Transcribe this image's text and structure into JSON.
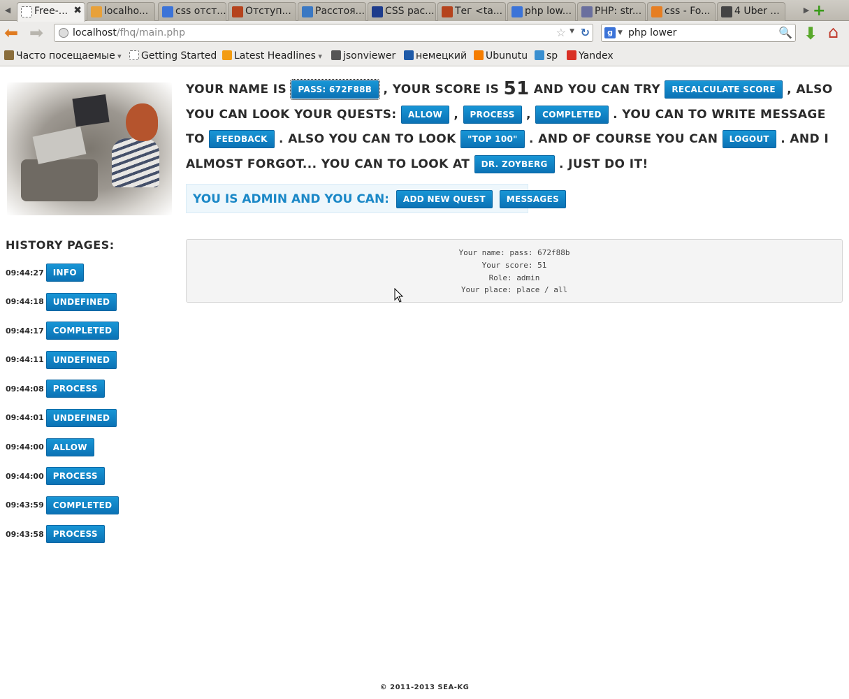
{
  "browser": {
    "tabs": [
      {
        "label": "Free-...",
        "icon": "page-icon",
        "color": "#ffffff",
        "active": true
      },
      {
        "label": "localho...",
        "icon": "pma-icon",
        "color": "#e8a13a"
      },
      {
        "label": "css отст...",
        "icon": "google-icon",
        "color": "#3b73d8"
      },
      {
        "label": "Отступ...",
        "icon": "htmlbook-icon",
        "color": "#b5431d"
      },
      {
        "label": "Расстоя...",
        "icon": "gear-icon",
        "color": "#3a78c3"
      },
      {
        "label": "CSS рас...",
        "icon": "a-icon",
        "color": "#1e3c8c"
      },
      {
        "label": "Тег <ta...",
        "icon": "htmlbook-icon",
        "color": "#b5431d"
      },
      {
        "label": "php low...",
        "icon": "google-icon",
        "color": "#3b73d8"
      },
      {
        "label": "PHP: str...",
        "icon": "php-icon",
        "color": "#6a6f9e"
      },
      {
        "label": "css - Fo...",
        "icon": "stackoverflow-icon",
        "color": "#e67e22"
      },
      {
        "label": "4 Uber ...",
        "icon": "page-icon",
        "color": "#444444"
      }
    ],
    "url_host": "localhost",
    "url_path": "/fhq/main.php",
    "search_value": "php lower",
    "bookmarks": [
      {
        "label": "Часто посещаемые",
        "icon": "most-visited-icon",
        "color": "#8a6d3b",
        "dropdown": true
      },
      {
        "label": "Getting Started",
        "icon": "page-icon",
        "color": "#ffffff"
      },
      {
        "label": "Latest Headlines",
        "icon": "rss-icon",
        "color": "#f39c12",
        "dropdown": true
      },
      {
        "label": "jsonviewer",
        "icon": "jsonviewer-icon",
        "color": "#555555"
      },
      {
        "label": "немецкий",
        "icon": "b-icon",
        "color": "#1e5aa8"
      },
      {
        "label": "Ubunutu",
        "icon": "blogger-icon",
        "color": "#f57d00"
      },
      {
        "label": "sp",
        "icon": "cart-icon",
        "color": "#3a8fd0"
      },
      {
        "label": "Yandex",
        "icon": "yandex-icon",
        "color": "#d93025"
      }
    ]
  },
  "intro": {
    "t1": "Your name is",
    "name_button": "pass: 672f88b",
    "t2": ", your score is",
    "score": "51",
    "t3": "and you can try",
    "recalc_button": "Recalculate score",
    "t4": ", also you can look your quests:",
    "allow_button": "Allow",
    "comma1": ",",
    "process_button": "Process",
    "comma2": ",",
    "completed_button": "Completed",
    "t5": ". You can to write message to",
    "feedback_button": "Feedback",
    "t6": ". Also you can to look",
    "top_button": "\"Top 100\"",
    "t7": ". And of course you can",
    "logout_button": "Logout",
    "t8": ". And I almost forgot... You can to look at",
    "zoyberg_button": "Dr. Zoyberg",
    "t9": ". Just do it!"
  },
  "admin": {
    "text": "You is admin and you can:",
    "add_quest_button": "Add new quest",
    "messages_button": "Messages"
  },
  "history": {
    "title": "History pages:",
    "items": [
      {
        "time": "09:44:27",
        "label": "Info"
      },
      {
        "time": "09:44:18",
        "label": "Undefined"
      },
      {
        "time": "09:44:17",
        "label": "Completed"
      },
      {
        "time": "09:44:11",
        "label": "Undefined"
      },
      {
        "time": "09:44:08",
        "label": "Process"
      },
      {
        "time": "09:44:01",
        "label": "Undefined"
      },
      {
        "time": "09:44:00",
        "label": "Allow"
      },
      {
        "time": "09:44:00",
        "label": "Process"
      },
      {
        "time": "09:43:59",
        "label": "Completed"
      },
      {
        "time": "09:43:58",
        "label": "Process"
      }
    ]
  },
  "info_panel": {
    "line1": "Your name: pass: 672f88b",
    "line2": "Your score: 51",
    "line3": "Role: admin",
    "line4": "Your place: place / all"
  },
  "footer": "© 2011-2013 sea-kg"
}
